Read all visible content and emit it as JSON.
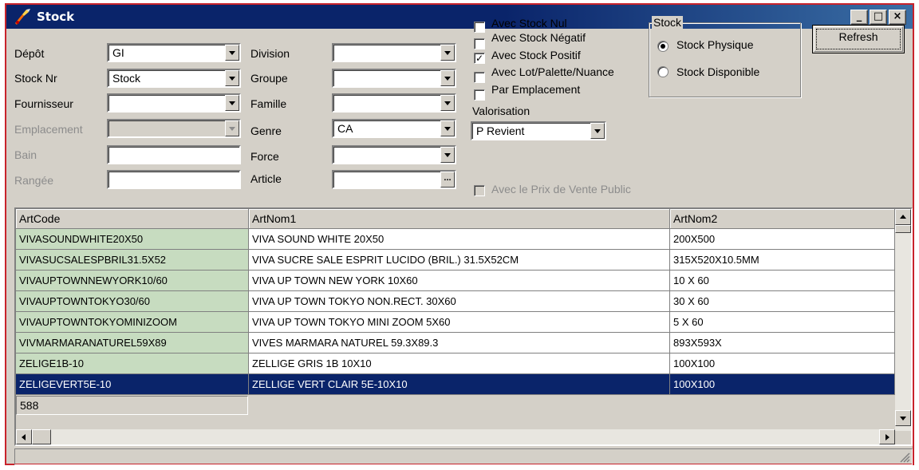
{
  "window": {
    "title": "Stock",
    "minimize_glyph": "_",
    "maximize_glyph": "□",
    "close_glyph": "×"
  },
  "filters": {
    "depot": {
      "label": "Dépôt",
      "value": "GI"
    },
    "stock_nr": {
      "label": "Stock Nr",
      "value": "Stock"
    },
    "fournisseur": {
      "label": "Fournisseur",
      "value": ""
    },
    "emplacement": {
      "label": "Emplacement",
      "value": ""
    },
    "bain": {
      "label": "Bain",
      "value": ""
    },
    "rangee": {
      "label": "Rangée",
      "value": ""
    },
    "division": {
      "label": "Division",
      "value": ""
    },
    "groupe": {
      "label": "Groupe",
      "value": ""
    },
    "famille": {
      "label": "Famille",
      "value": ""
    },
    "genre": {
      "label": "Genre",
      "value": "CA"
    },
    "force": {
      "label": "Force",
      "value": ""
    },
    "article": {
      "label": "Article",
      "value": "",
      "button_label": "..."
    }
  },
  "options": {
    "avec_stock_nul": {
      "label": "Avec Stock Nul",
      "checked": false
    },
    "avec_stock_negatif": {
      "label": "Avec Stock Négatif",
      "checked": false
    },
    "avec_stock_positif": {
      "label": "Avec Stock Positif",
      "checked": true
    },
    "avec_lot": {
      "label": "Avec Lot/Palette/Nuance",
      "checked": false
    },
    "par_emplacement": {
      "label": "Par Emplacement",
      "checked": false
    },
    "valorisation_label": "Valorisation",
    "valorisation_value": "P Revient",
    "prix_vente_public": {
      "label": "Avec le Prix de Vente Public",
      "checked": false
    },
    "check_mark": "✓"
  },
  "stock_group": {
    "legend": "Stock",
    "physique": {
      "label": "Stock Physique",
      "selected": true
    },
    "disponible": {
      "label": "Stock Disponible",
      "selected": false
    }
  },
  "refresh_label": "Refresh",
  "grid": {
    "columns": [
      "ArtCode",
      "ArtNom1",
      "ArtNom2"
    ],
    "rows": [
      [
        "VIVASOUNDWHITE20X50",
        "VIVA  SOUND WHITE 20X50",
        "200X500"
      ],
      [
        "VIVASUCSALESPBRIL31.5X52",
        "VIVA SUCRE SALE ESPRIT LUCIDO (BRIL.) 31.5X52CM",
        "315X520X10.5MM"
      ],
      [
        "VIVAUPTOWNNEWYORK10/60",
        "VIVA UP TOWN NEW YORK 10X60",
        "10 X 60"
      ],
      [
        "VIVAUPTOWNTOKYO30/60",
        "VIVA UP TOWN TOKYO NON.RECT. 30X60",
        "30 X 60"
      ],
      [
        "VIVAUPTOWNTOKYOMINIZOOM",
        "VIVA UP TOWN TOKYO MINI ZOOM 5X60",
        "5 X 60"
      ],
      [
        "VIVMARMARANATUREL59X89",
        "VIVES MARMARA NATUREL 59.3X89.3",
        "893X593X"
      ],
      [
        "ZELIGE1B-10",
        "ZELLIGE GRIS 1B 10X10",
        "100X100"
      ],
      [
        "ZELIGEVERT5E-10",
        "ZELLIGE VERT CLAIR 5E-10X10",
        "100X100"
      ]
    ],
    "selected_row": 7,
    "record_count": "588"
  }
}
